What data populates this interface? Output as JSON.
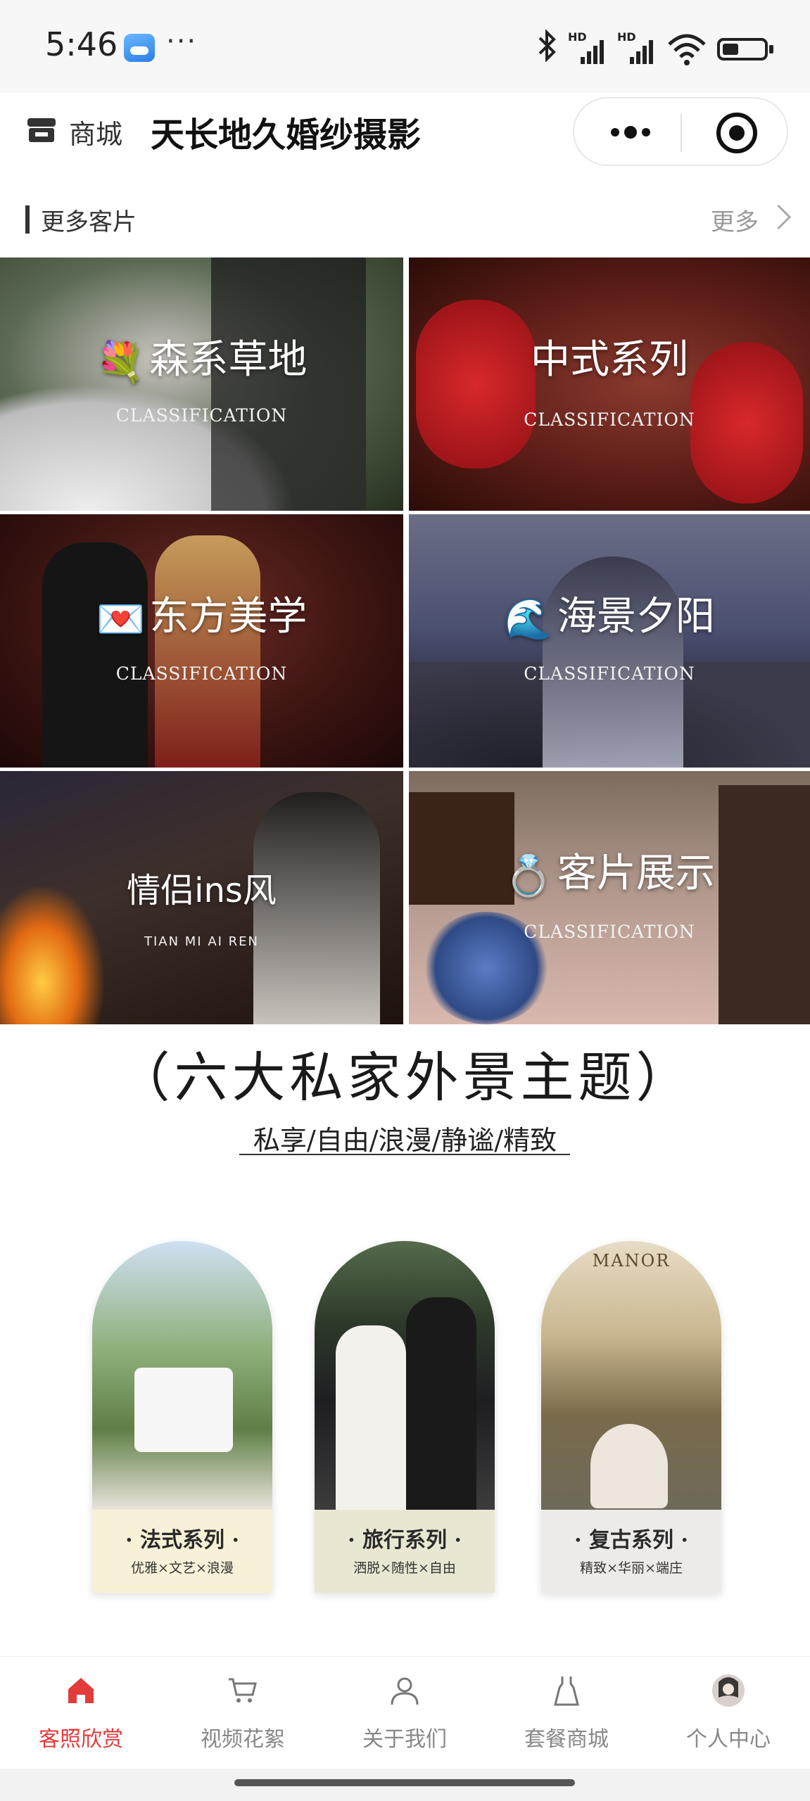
{
  "status_bar": {
    "time": "5:46",
    "overflow": "···",
    "signal_tag": "HD"
  },
  "nav": {
    "shop_label": "商城",
    "title": "天长地久婚纱摄影"
  },
  "section": {
    "title": "更多客片",
    "more": "更多"
  },
  "gallery": [
    {
      "title": "森系草地",
      "emoji": "💐",
      "subtitle": "CLASSIFICATION"
    },
    {
      "title": "中式系列",
      "emoji": "",
      "subtitle": "CLASSIFICATION"
    },
    {
      "title": "东方美学",
      "emoji": "💌",
      "subtitle": "CLASSIFICATION"
    },
    {
      "title": "海景夕阳",
      "emoji": "🌊",
      "subtitle": "CLASSIFICATION"
    },
    {
      "title": "情侣ins风",
      "emoji": "",
      "subtitle": "TIAN MI AI REN"
    },
    {
      "title": "客片展示",
      "emoji": "💍",
      "subtitle": "CLASSIFICATION"
    }
  ],
  "banner": {
    "title": "（六大私家外景主题）",
    "subtitle": "私享/自由/浪漫/静谧/精致",
    "manor_text": "MANOR",
    "themes": [
      {
        "name": "· 法式系列 ·",
        "desc": "优雅×文艺×浪漫"
      },
      {
        "name": "· 旅行系列 ·",
        "desc": "洒脱×随性×自由"
      },
      {
        "name": "· 复古系列 ·",
        "desc": "精致×华丽×端庄"
      }
    ]
  },
  "tabs": [
    {
      "label": "客照欣赏",
      "icon": "home-icon",
      "active": true
    },
    {
      "label": "视频花絮",
      "icon": "cart-icon",
      "active": false
    },
    {
      "label": "关于我们",
      "icon": "person-icon",
      "active": false
    },
    {
      "label": "套餐商城",
      "icon": "dress-icon",
      "active": false
    },
    {
      "label": "个人中心",
      "icon": "avatar",
      "active": false
    }
  ],
  "colors": {
    "accent": "#e23b3b",
    "inactive": "#888888"
  }
}
